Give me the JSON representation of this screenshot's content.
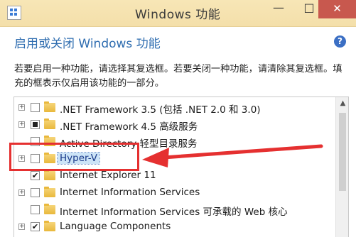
{
  "window": {
    "title": "Windows 功能",
    "minimize_label": "—",
    "maximize_label": "□",
    "close_label": "✕"
  },
  "header": {
    "heading": "启用或关闭 Windows 功能",
    "help_label": "?",
    "description": "若要启用一种功能，请选择其复选框。若要关闭一种功能，请清除其复选框。填充的框表示仅启用该功能的一部分。"
  },
  "features": [
    {
      "label": ".NET Framework 3.5 (包括 .NET 2.0 和 3.0)",
      "expandable": true,
      "state": "unchecked"
    },
    {
      "label": ".NET Framework 4.5 高级服务",
      "expandable": true,
      "state": "partial"
    },
    {
      "label": "Active Directory 轻型目录服务",
      "expandable": false,
      "state": "unchecked"
    },
    {
      "label": "Hyper-V",
      "expandable": true,
      "state": "unchecked",
      "selected": true
    },
    {
      "label": "Internet Explorer 11",
      "expandable": false,
      "state": "checked"
    },
    {
      "label": "Internet Information Services",
      "expandable": true,
      "state": "unchecked"
    },
    {
      "label": "Internet Information Services 可承载的 Web 核心",
      "expandable": false,
      "state": "unchecked"
    },
    {
      "label": "Language Components",
      "expandable": true,
      "state": "checked"
    }
  ],
  "colors": {
    "accent": "#2f6db0",
    "annotation": "#e53030",
    "selection": "#cce4f7"
  }
}
